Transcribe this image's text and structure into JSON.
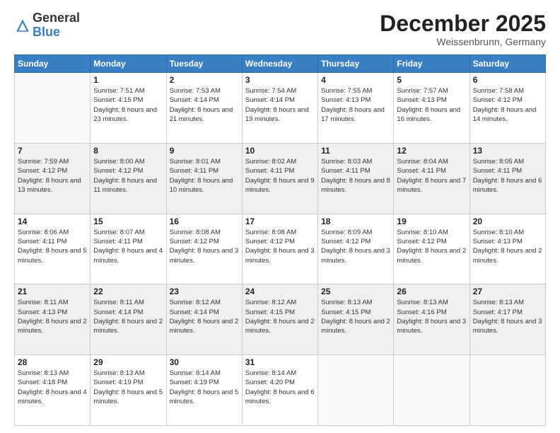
{
  "logo": {
    "general": "General",
    "blue": "Blue"
  },
  "header": {
    "month": "December 2025",
    "location": "Weissenbrunn, Germany"
  },
  "weekdays": [
    "Sunday",
    "Monday",
    "Tuesday",
    "Wednesday",
    "Thursday",
    "Friday",
    "Saturday"
  ],
  "weeks": [
    [
      {
        "day": "",
        "sunrise": "",
        "sunset": "",
        "daylight": ""
      },
      {
        "day": "1",
        "sunrise": "Sunrise: 7:51 AM",
        "sunset": "Sunset: 4:15 PM",
        "daylight": "Daylight: 8 hours and 23 minutes."
      },
      {
        "day": "2",
        "sunrise": "Sunrise: 7:53 AM",
        "sunset": "Sunset: 4:14 PM",
        "daylight": "Daylight: 8 hours and 21 minutes."
      },
      {
        "day": "3",
        "sunrise": "Sunrise: 7:54 AM",
        "sunset": "Sunset: 4:14 PM",
        "daylight": "Daylight: 8 hours and 19 minutes."
      },
      {
        "day": "4",
        "sunrise": "Sunrise: 7:55 AM",
        "sunset": "Sunset: 4:13 PM",
        "daylight": "Daylight: 8 hours and 17 minutes."
      },
      {
        "day": "5",
        "sunrise": "Sunrise: 7:57 AM",
        "sunset": "Sunset: 4:13 PM",
        "daylight": "Daylight: 8 hours and 16 minutes."
      },
      {
        "day": "6",
        "sunrise": "Sunrise: 7:58 AM",
        "sunset": "Sunset: 4:12 PM",
        "daylight": "Daylight: 8 hours and 14 minutes."
      }
    ],
    [
      {
        "day": "7",
        "sunrise": "Sunrise: 7:59 AM",
        "sunset": "Sunset: 4:12 PM",
        "daylight": "Daylight: 8 hours and 13 minutes."
      },
      {
        "day": "8",
        "sunrise": "Sunrise: 8:00 AM",
        "sunset": "Sunset: 4:12 PM",
        "daylight": "Daylight: 8 hours and 11 minutes."
      },
      {
        "day": "9",
        "sunrise": "Sunrise: 8:01 AM",
        "sunset": "Sunset: 4:11 PM",
        "daylight": "Daylight: 8 hours and 10 minutes."
      },
      {
        "day": "10",
        "sunrise": "Sunrise: 8:02 AM",
        "sunset": "Sunset: 4:11 PM",
        "daylight": "Daylight: 8 hours and 9 minutes."
      },
      {
        "day": "11",
        "sunrise": "Sunrise: 8:03 AM",
        "sunset": "Sunset: 4:11 PM",
        "daylight": "Daylight: 8 hours and 8 minutes."
      },
      {
        "day": "12",
        "sunrise": "Sunrise: 8:04 AM",
        "sunset": "Sunset: 4:11 PM",
        "daylight": "Daylight: 8 hours and 7 minutes."
      },
      {
        "day": "13",
        "sunrise": "Sunrise: 8:05 AM",
        "sunset": "Sunset: 4:11 PM",
        "daylight": "Daylight: 8 hours and 6 minutes."
      }
    ],
    [
      {
        "day": "14",
        "sunrise": "Sunrise: 8:06 AM",
        "sunset": "Sunset: 4:11 PM",
        "daylight": "Daylight: 8 hours and 5 minutes."
      },
      {
        "day": "15",
        "sunrise": "Sunrise: 8:07 AM",
        "sunset": "Sunset: 4:11 PM",
        "daylight": "Daylight: 8 hours and 4 minutes."
      },
      {
        "day": "16",
        "sunrise": "Sunrise: 8:08 AM",
        "sunset": "Sunset: 4:12 PM",
        "daylight": "Daylight: 8 hours and 3 minutes."
      },
      {
        "day": "17",
        "sunrise": "Sunrise: 8:08 AM",
        "sunset": "Sunset: 4:12 PM",
        "daylight": "Daylight: 8 hours and 3 minutes."
      },
      {
        "day": "18",
        "sunrise": "Sunrise: 8:09 AM",
        "sunset": "Sunset: 4:12 PM",
        "daylight": "Daylight: 8 hours and 3 minutes."
      },
      {
        "day": "19",
        "sunrise": "Sunrise: 8:10 AM",
        "sunset": "Sunset: 4:12 PM",
        "daylight": "Daylight: 8 hours and 2 minutes."
      },
      {
        "day": "20",
        "sunrise": "Sunrise: 8:10 AM",
        "sunset": "Sunset: 4:13 PM",
        "daylight": "Daylight: 8 hours and 2 minutes."
      }
    ],
    [
      {
        "day": "21",
        "sunrise": "Sunrise: 8:11 AM",
        "sunset": "Sunset: 4:13 PM",
        "daylight": "Daylight: 8 hours and 2 minutes."
      },
      {
        "day": "22",
        "sunrise": "Sunrise: 8:11 AM",
        "sunset": "Sunset: 4:14 PM",
        "daylight": "Daylight: 8 hours and 2 minutes."
      },
      {
        "day": "23",
        "sunrise": "Sunrise: 8:12 AM",
        "sunset": "Sunset: 4:14 PM",
        "daylight": "Daylight: 8 hours and 2 minutes."
      },
      {
        "day": "24",
        "sunrise": "Sunrise: 8:12 AM",
        "sunset": "Sunset: 4:15 PM",
        "daylight": "Daylight: 8 hours and 2 minutes."
      },
      {
        "day": "25",
        "sunrise": "Sunrise: 8:13 AM",
        "sunset": "Sunset: 4:15 PM",
        "daylight": "Daylight: 8 hours and 2 minutes."
      },
      {
        "day": "26",
        "sunrise": "Sunrise: 8:13 AM",
        "sunset": "Sunset: 4:16 PM",
        "daylight": "Daylight: 8 hours and 3 minutes."
      },
      {
        "day": "27",
        "sunrise": "Sunrise: 8:13 AM",
        "sunset": "Sunset: 4:17 PM",
        "daylight": "Daylight: 8 hours and 3 minutes."
      }
    ],
    [
      {
        "day": "28",
        "sunrise": "Sunrise: 8:13 AM",
        "sunset": "Sunset: 4:18 PM",
        "daylight": "Daylight: 8 hours and 4 minutes."
      },
      {
        "day": "29",
        "sunrise": "Sunrise: 8:13 AM",
        "sunset": "Sunset: 4:19 PM",
        "daylight": "Daylight: 8 hours and 5 minutes."
      },
      {
        "day": "30",
        "sunrise": "Sunrise: 8:14 AM",
        "sunset": "Sunset: 4:19 PM",
        "daylight": "Daylight: 8 hours and 5 minutes."
      },
      {
        "day": "31",
        "sunrise": "Sunrise: 8:14 AM",
        "sunset": "Sunset: 4:20 PM",
        "daylight": "Daylight: 8 hours and 6 minutes."
      },
      {
        "day": "",
        "sunrise": "",
        "sunset": "",
        "daylight": ""
      },
      {
        "day": "",
        "sunrise": "",
        "sunset": "",
        "daylight": ""
      },
      {
        "day": "",
        "sunrise": "",
        "sunset": "",
        "daylight": ""
      }
    ]
  ]
}
